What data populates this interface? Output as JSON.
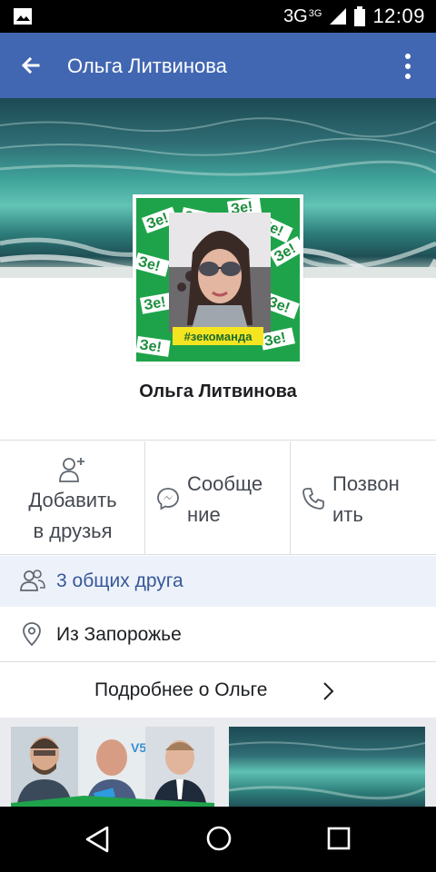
{
  "status_bar": {
    "network": "3G",
    "network_sup": "3G",
    "time": "12:09",
    "icons": [
      "image-notification-icon",
      "signal-icon",
      "battery-icon"
    ]
  },
  "toolbar": {
    "title": "Ольга Литвинова",
    "back_icon": "arrow-left-icon",
    "menu_icon": "more-vertical-icon",
    "color": "#4267b2"
  },
  "profile": {
    "name": "Ольга Литвинова",
    "avatar_banner_text": "#зекоманда",
    "avatar_pattern_text": "Зе!"
  },
  "actions": [
    {
      "id": "add",
      "label_line1": "Добавить",
      "label_line2": "в друзья",
      "icon": "add-friend-icon"
    },
    {
      "id": "message",
      "label_line1": "Сообще",
      "label_line2": "ние",
      "icon": "messenger-icon"
    },
    {
      "id": "call",
      "label_line1": "Позвон",
      "label_line2": "ить",
      "icon": "phone-icon"
    }
  ],
  "info": {
    "mutual_friends": "3 общих друга",
    "location": "Из Запорожье",
    "more_about": "Подробнее о Ольге"
  },
  "nav": {
    "icons": [
      "nav-back-icon",
      "nav-home-icon",
      "nav-recents-icon"
    ]
  },
  "colors": {
    "link_blue": "#365899",
    "mutual_bg": "#edf2fa",
    "green_frame": "#1fa34a"
  }
}
